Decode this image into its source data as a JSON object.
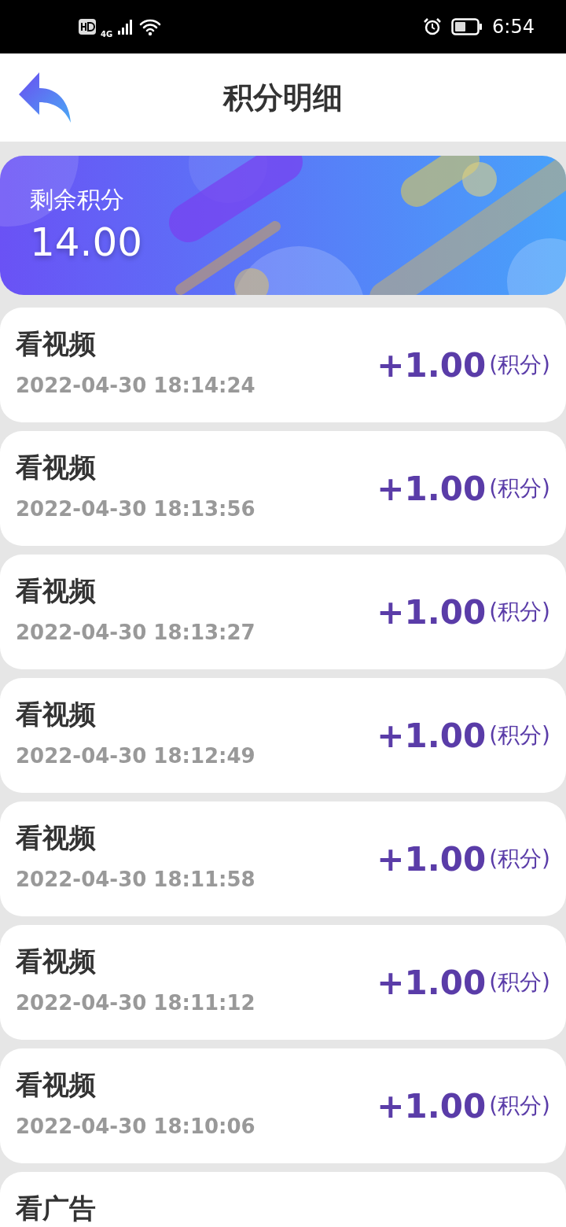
{
  "status_bar": {
    "time": "6:54",
    "network": "4G"
  },
  "header": {
    "title": "积分明细"
  },
  "balance": {
    "label": "剩余积分",
    "value": "14.00"
  },
  "records": [
    {
      "title": "看视频",
      "time": "2022-04-30 18:14:24",
      "amount": "+1.00",
      "unit": "(积分)"
    },
    {
      "title": "看视频",
      "time": "2022-04-30 18:13:56",
      "amount": "+1.00",
      "unit": "(积分)"
    },
    {
      "title": "看视频",
      "time": "2022-04-30 18:13:27",
      "amount": "+1.00",
      "unit": "(积分)"
    },
    {
      "title": "看视频",
      "time": "2022-04-30 18:12:49",
      "amount": "+1.00",
      "unit": "(积分)"
    },
    {
      "title": "看视频",
      "time": "2022-04-30 18:11:58",
      "amount": "+1.00",
      "unit": "(积分)"
    },
    {
      "title": "看视频",
      "time": "2022-04-30 18:11:12",
      "amount": "+1.00",
      "unit": "(积分)"
    },
    {
      "title": "看视频",
      "time": "2022-04-30 18:10:06",
      "amount": "+1.00",
      "unit": "(积分)"
    },
    {
      "title": "看广告"
    }
  ]
}
